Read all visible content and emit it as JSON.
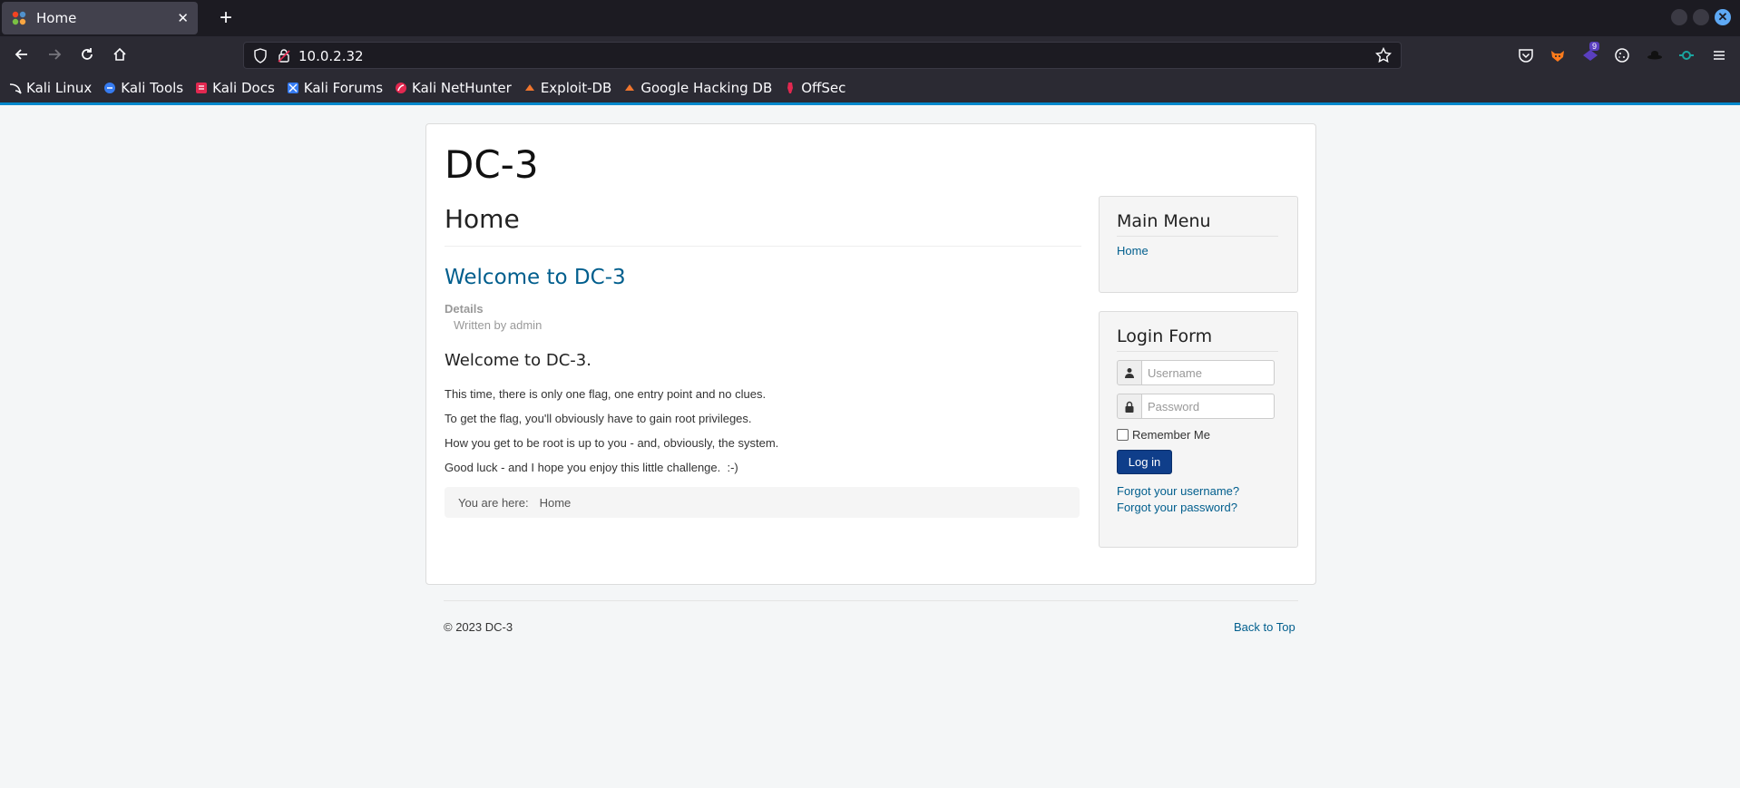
{
  "browser": {
    "tab_title": "Home",
    "url": "10.0.2.32",
    "bookmarks": [
      "Kali Linux",
      "Kali Tools",
      "Kali Docs",
      "Kali Forums",
      "Kali NetHunter",
      "Exploit-DB",
      "Google Hacking DB",
      "OffSec"
    ],
    "extension_badge": "9",
    "accent_color": "#0088cc"
  },
  "site": {
    "title": "DC-3",
    "page_heading": "Home"
  },
  "article": {
    "title": "Welcome to DC-3",
    "details_label": "Details",
    "written_by": "Written by admin",
    "heading": "Welcome to DC-3.",
    "paragraphs": [
      "This time, there is only one flag, one entry point and no clues.",
      "To get the flag, you'll obviously have to gain root privileges.",
      "How you get to be root is up to you - and, obviously, the system.",
      "Good luck - and I hope you enjoy this little challenge.  :-)"
    ]
  },
  "breadcrumb": {
    "prefix": "You are here:",
    "current": "Home"
  },
  "main_menu": {
    "title": "Main Menu",
    "items": [
      "Home"
    ]
  },
  "login_form": {
    "title": "Login Form",
    "username_placeholder": "Username",
    "password_placeholder": "Password",
    "remember_label": "Remember Me",
    "submit_label": "Log in",
    "forgot_username": "Forgot your username?",
    "forgot_password": "Forgot your password?"
  },
  "footer": {
    "copyright": "© 2023 DC-3",
    "back_to_top": "Back to Top"
  }
}
